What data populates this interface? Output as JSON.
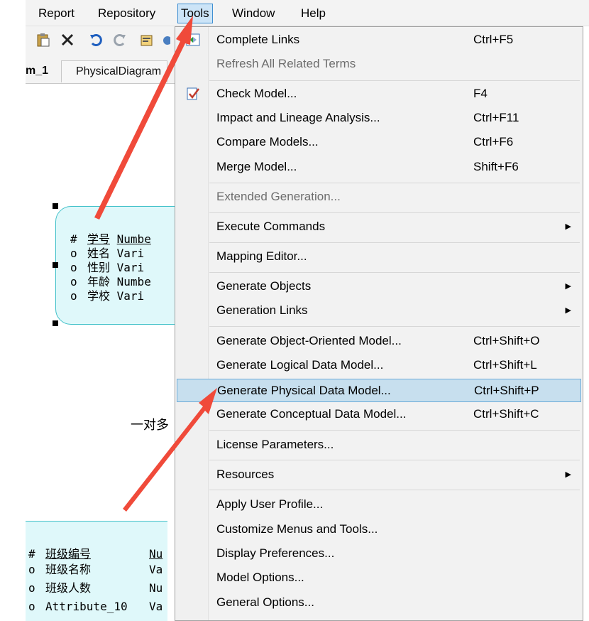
{
  "menubar": [
    "Report",
    "Repository",
    "Tools",
    "Window",
    "Help"
  ],
  "tabs": {
    "diagram1": "m_1",
    "diagram2": "PhysicalDiagram"
  },
  "entity1": {
    "attributes": [
      {
        "marker": "#",
        "name": "学号",
        "type": "Numbe"
      },
      {
        "marker": "o",
        "name": "姓名",
        "type": "Vari"
      },
      {
        "marker": "o",
        "name": "性别",
        "type": "Vari"
      },
      {
        "marker": "o",
        "name": "年龄",
        "type": "Numbe"
      },
      {
        "marker": "o",
        "name": "学校",
        "type": "Vari"
      }
    ]
  },
  "relation_label": "一对多",
  "entity2": {
    "attributes": [
      {
        "marker": "#",
        "name": "班级编号",
        "type": "Nu"
      },
      {
        "marker": "o",
        "name": "班级名称",
        "type": "Va"
      },
      {
        "marker": "o",
        "name": "班级人数",
        "type": "Nu"
      },
      {
        "marker": "o",
        "name": "Attribute_10",
        "type": "Va"
      }
    ]
  },
  "menu": {
    "complete_links": {
      "label": "Complete Links",
      "shortcut": "Ctrl+F5"
    },
    "refresh_terms": {
      "label": "Refresh All Related Terms"
    },
    "check_model": {
      "label": "Check Model...",
      "shortcut": "F4"
    },
    "impact_analysis": {
      "label": "Impact and Lineage Analysis...",
      "shortcut": "Ctrl+F11"
    },
    "compare_models": {
      "label": "Compare Models...",
      "shortcut": "Ctrl+F6"
    },
    "merge_model": {
      "label": "Merge Model...",
      "shortcut": "Shift+F6"
    },
    "extended_generation": {
      "label": "Extended Generation..."
    },
    "execute_commands": {
      "label": "Execute Commands"
    },
    "mapping_editor": {
      "label": "Mapping Editor..."
    },
    "generate_objects": {
      "label": "Generate Objects"
    },
    "generation_links": {
      "label": "Generation Links"
    },
    "gen_oom": {
      "label": "Generate Object-Oriented Model...",
      "shortcut": "Ctrl+Shift+O"
    },
    "gen_ldm": {
      "label": "Generate Logical Data Model...",
      "shortcut": "Ctrl+Shift+L"
    },
    "gen_pdm": {
      "label": "Generate Physical Data Model...",
      "shortcut": "Ctrl+Shift+P"
    },
    "gen_cdm": {
      "label": "Generate Conceptual Data Model...",
      "shortcut": "Ctrl+Shift+C"
    },
    "license_params": {
      "label": "License Parameters..."
    },
    "resources": {
      "label": "Resources"
    },
    "apply_profile": {
      "label": "Apply User Profile..."
    },
    "customize_menus": {
      "label": "Customize Menus and Tools..."
    },
    "display_prefs": {
      "label": "Display Preferences..."
    },
    "model_options": {
      "label": "Model Options..."
    },
    "general_options": {
      "label": "General Options..."
    }
  },
  "colors": {
    "arrow": "#f04a3a",
    "highlight": "#c7dfee",
    "entity_fill": "#dff8fa",
    "entity_border": "#42c1c9"
  }
}
